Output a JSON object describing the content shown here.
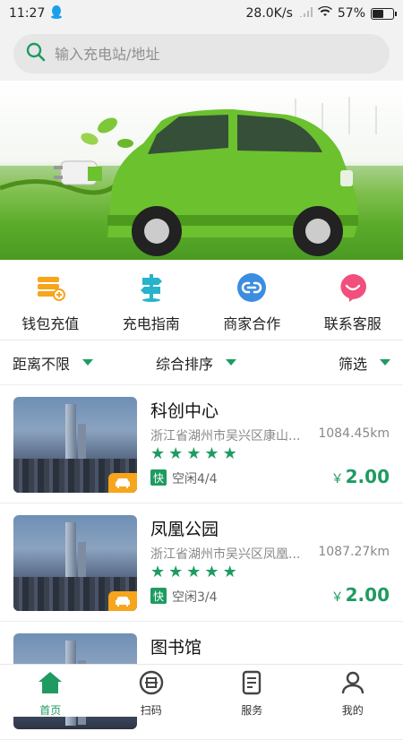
{
  "status_bar": {
    "time": "11:27",
    "speed": "28.0K/s",
    "battery": "57%",
    "battery_level": 0.57
  },
  "search": {
    "placeholder": "输入充电站/地址"
  },
  "quick_actions": [
    {
      "label": "钱包充值",
      "icon": "wallet-stack-icon",
      "color": "#f7a51c"
    },
    {
      "label": "充电指南",
      "icon": "signpost-icon",
      "color": "#27b3c9"
    },
    {
      "label": "商家合作",
      "icon": "link-icon",
      "color": "#3b8de0"
    },
    {
      "label": "联系客服",
      "icon": "chat-heart-icon",
      "color": "#f24f7c"
    }
  ],
  "filters": [
    {
      "label": "距离不限"
    },
    {
      "label": "综合排序"
    },
    {
      "label": "筛选"
    }
  ],
  "stations": [
    {
      "name": "科创中心",
      "address": "浙江省湖州市吴兴区康山...",
      "distance": "1084.45km",
      "rating": 5,
      "fast_tag": "快",
      "idle": "空闲4/4",
      "currency": "￥",
      "price": "2.00"
    },
    {
      "name": "凤凰公园",
      "address": "浙江省湖州市吴兴区凤凰...",
      "distance": "1087.27km",
      "rating": 5,
      "fast_tag": "快",
      "idle": "空闲3/4",
      "currency": "￥",
      "price": "2.00"
    },
    {
      "name": "图书馆"
    }
  ],
  "tabs": [
    {
      "label": "首页",
      "active": true,
      "icon": "home-icon"
    },
    {
      "label": "扫码",
      "icon": "scan-icon"
    },
    {
      "label": "服务",
      "icon": "document-icon"
    },
    {
      "label": "我的",
      "icon": "user-icon"
    }
  ],
  "colors": {
    "accent": "#1f9b62",
    "car": "#6cc12e",
    "badge": "#f7a51c"
  }
}
